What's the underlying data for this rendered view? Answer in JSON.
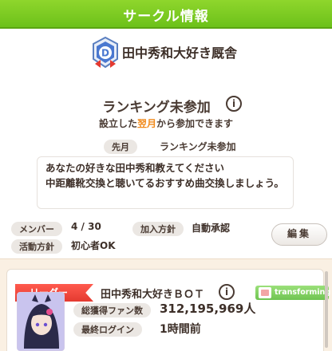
{
  "header": {
    "title": "サークル情報"
  },
  "circle": {
    "name": "田中秀和大好き厩舎",
    "emblem_icon": "circle-emblem-D-icon"
  },
  "ranking": {
    "title": "ランキング未参加",
    "subtitle_before": "設立した",
    "subtitle_highlight": "翌月",
    "subtitle_after": "から参加できます"
  },
  "last_month": {
    "label": "先月",
    "value": "ランキング未参加"
  },
  "message": "あなたの好きな田中秀和教えてください\n中距離靴交換と聴いてるおすすめ曲交換しましょう。",
  "stats": {
    "members_label": "メンバー",
    "members_value": "4 / 30",
    "join_label": "加入方針",
    "join_value": "自動承認",
    "policy_label": "活動方針",
    "policy_value": "初心者OK"
  },
  "edit_button": "編集",
  "leader": {
    "tag": "リーダー",
    "name": "田中秀和大好きＢＯＴ",
    "badge": "transforming",
    "fans_label": "総獲得ファン数",
    "fans_value": "312,195,969人",
    "login_label": "最終ログイン",
    "login_value": "1時間前"
  },
  "colors": {
    "header_green": "#6cc11a",
    "leader_red": "#e43a30",
    "highlight_orange": "#f08a1c",
    "badge_green": "#6fc451"
  }
}
